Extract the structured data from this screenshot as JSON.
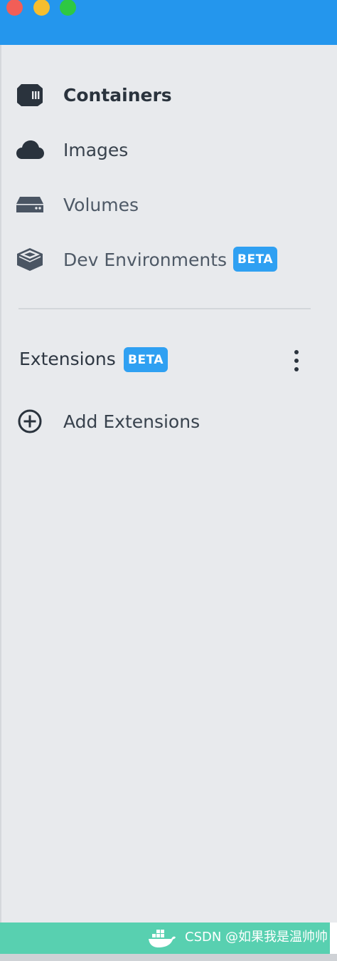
{
  "window": {
    "controls": [
      "close",
      "minimize",
      "zoom"
    ],
    "titlebar_color": "#2496ed"
  },
  "sidebar": {
    "items": [
      {
        "label": "Containers",
        "icon": "container-icon",
        "active": true
      },
      {
        "label": "Images",
        "icon": "cloud-icon",
        "active": false
      },
      {
        "label": "Volumes",
        "icon": "volume-drive-icon",
        "active": false
      },
      {
        "label": "Dev Environments",
        "icon": "dev-environments-icon",
        "active": false,
        "badge": "BETA"
      }
    ]
  },
  "extensions": {
    "title": "Extensions",
    "badge": "BETA",
    "menu_icon": "kebab-menu-icon",
    "add_label": "Add Extensions",
    "add_icon": "plus-circle-icon"
  },
  "footer": {
    "icon": "docker-whale-icon",
    "watermark": "CSDN @如果我是温帅帅",
    "color": "#58d0b0"
  },
  "colors": {
    "accent": "#2496ed",
    "badge": "#2fa0f2",
    "sidebar_bg": "#e8eaed"
  }
}
